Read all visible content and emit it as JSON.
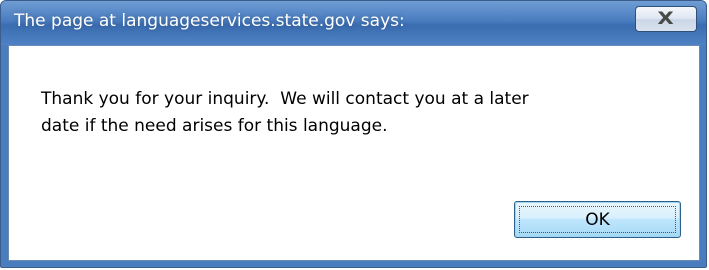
{
  "dialog": {
    "title": "The page at languageservices.state.gov says:",
    "close_label": "X",
    "message": "Thank you for your inquiry.  We will contact you at a later\ndate if the need arises for this language.",
    "ok_label": "OK"
  },
  "colors": {
    "titlebar": "#4a7dc0",
    "frame": "#4a7dbd",
    "client_bg": "#ffffff",
    "ok_button": "#bee6fd"
  },
  "icons": {
    "close": "close-icon"
  }
}
